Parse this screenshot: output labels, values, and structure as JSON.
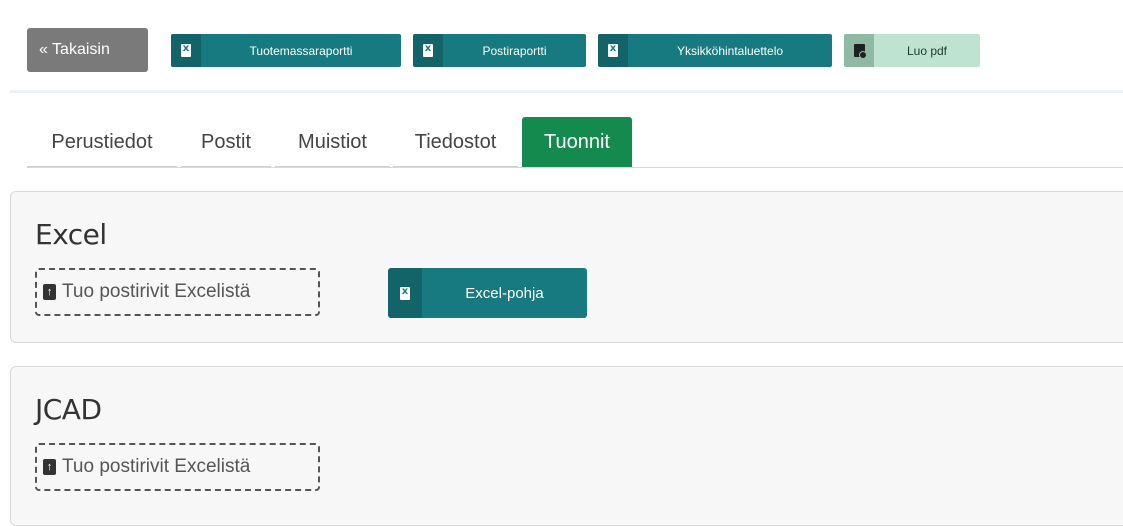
{
  "toolbar": {
    "back_label": "« Takaisin",
    "buttons": [
      {
        "label": "Tuotemassaraportti",
        "icon": "excel-file-icon"
      },
      {
        "label": "Postiraportti",
        "icon": "excel-file-icon"
      },
      {
        "label": "Yksikköhintaluettelo",
        "icon": "excel-file-icon"
      },
      {
        "label": "Luo pdf",
        "icon": "pdf-file-icon"
      }
    ]
  },
  "tabs": [
    {
      "label": "Perustiedot",
      "active": false
    },
    {
      "label": "Postit",
      "active": false
    },
    {
      "label": "Muistiot",
      "active": false
    },
    {
      "label": "Tiedostot",
      "active": false
    },
    {
      "label": "Tuonnit",
      "active": true
    }
  ],
  "sections": {
    "excel": {
      "title": "Excel",
      "import_label": "Tuo postirivit Excelistä",
      "template_button": "Excel-pohja"
    },
    "jcad": {
      "title": "JCAD",
      "import_label": "Tuo postirivit Excelistä"
    }
  },
  "colors": {
    "teal": "#167a80",
    "active_tab": "#158a4e",
    "pdf_button": "#bfe3d1",
    "back_button": "#7a7a7a"
  }
}
